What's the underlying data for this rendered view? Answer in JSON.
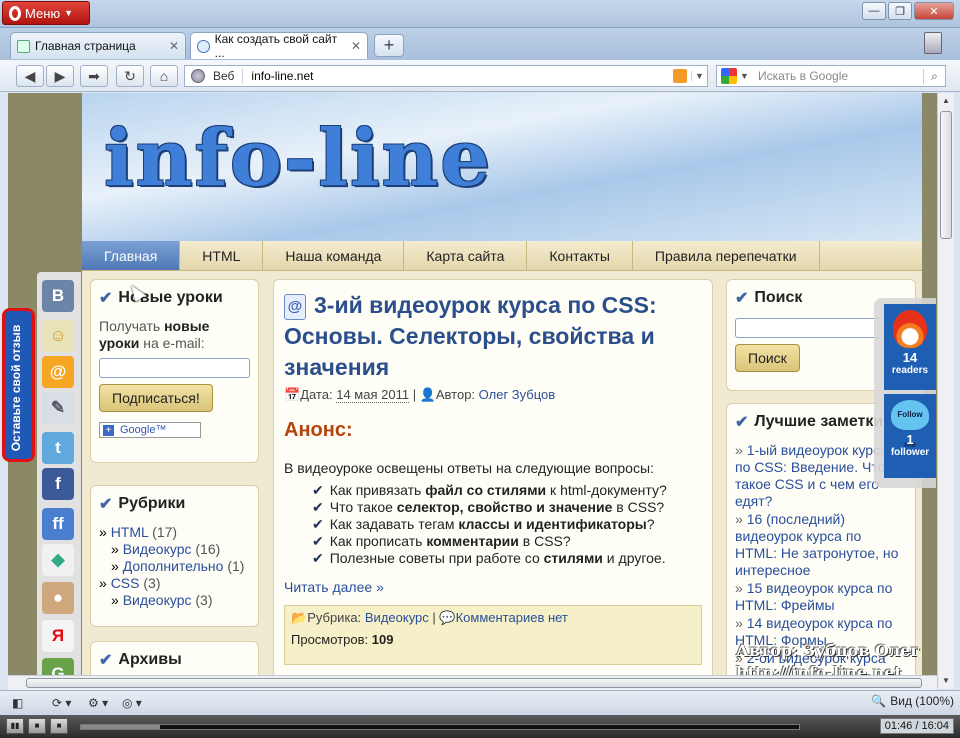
{
  "browser": {
    "menu_label": "Меню",
    "tabs": [
      {
        "label": "Главная страница"
      },
      {
        "label": "Как создать свой сайт ..."
      }
    ],
    "address": {
      "prefix": "Веб",
      "url": "info-line.net"
    },
    "search": {
      "placeholder": "Искать в Google"
    },
    "zoom_label": "Вид (100%)"
  },
  "site": {
    "logo_text": "info-line",
    "nav": [
      "Главная",
      "HTML",
      "Наша команда",
      "Карта сайта",
      "Контакты",
      "Правила перепечатки"
    ],
    "feedback_tab": "Оставьте свой отзыв",
    "left": {
      "new_lessons_title": "Новые уроки",
      "subscribe_pre": "Получать ",
      "subscribe_bold": "новые уроки",
      "subscribe_post": " на e-mail:",
      "subscribe_button": "Подписаться!",
      "google_badge": "Google™",
      "rubrics_title": "Рубрики",
      "rubrics": [
        {
          "name": "HTML",
          "count": "(17)",
          "level": 0
        },
        {
          "name": "Видеокурс",
          "count": "(16)",
          "level": 1
        },
        {
          "name": "Дополнительно",
          "count": "(1)",
          "level": 1
        },
        {
          "name": "CSS",
          "count": "(3)",
          "level": 0
        },
        {
          "name": "Видеокурс",
          "count": "(3)",
          "level": 1
        }
      ],
      "archives_title": "Архивы"
    },
    "post": {
      "title": "3-ий видеоурок курса по CSS: Основы. Селекторы, свойства и значения",
      "date_label": "Дата:",
      "date": "14 мая 2011",
      "author_label": "Автор:",
      "author": "Олег Зубцов",
      "anons": "Анонс:",
      "intro": "В видеоуроке освещены ответы на следующие вопросы:",
      "questions": [
        {
          "a": "Как привязать ",
          "b": "файл со стилями",
          "c": " к html-документу?"
        },
        {
          "a": "Что такое ",
          "b": "селектор, свойство и значение",
          "c": " в CSS?"
        },
        {
          "a": "Как задавать тегам ",
          "b": "классы и идентификаторы",
          "c": "?"
        },
        {
          "a": "Как прописать ",
          "b": "комментарии",
          "c": " в CSS?"
        },
        {
          "a": "Полезные советы при работе со ",
          "b": "стилями",
          "c": " и другое."
        }
      ],
      "read_more": "Читать далее »",
      "rubric_label": "Рубрика:",
      "rubric": "Видеокурс",
      "comments": "Комментариев нет",
      "views_label": "Просмотров:",
      "views": "109"
    },
    "right": {
      "search_title": "Поиск",
      "search_button": "Поиск",
      "best_title": "Лучшие заметки",
      "best": [
        "1-ый видеоурок курса по CSS: Введение. Что такое CSS и с чем его едят?",
        "16 (последний) видеоурок курса по HTML: Не затронутое, но интересное",
        "15 видеоурок курса по HTML: Фреймы",
        "14 видеоурок курса по HTML: Формы",
        "2-ой видеоурок курса"
      ]
    },
    "feedburner": {
      "readers_count": "14",
      "readers_label": "readers",
      "followers_count": "1",
      "followers_label": "follower",
      "follow_badge": "Follow me"
    }
  },
  "watermark": [
    "Автор: Зубцов Олег",
    "http://info-line.net"
  ],
  "player": {
    "time": "01:46 / 16:04",
    "progress": 0.11
  }
}
